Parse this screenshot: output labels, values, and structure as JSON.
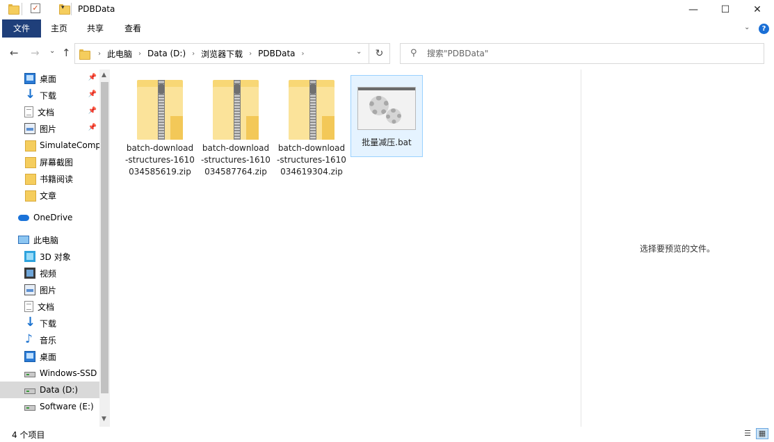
{
  "window": {
    "title": "PDBData",
    "controls": {
      "minimize": "—",
      "maximize": "☐",
      "close": "✕"
    }
  },
  "ribbon": {
    "tabs": [
      {
        "label": "文件"
      },
      {
        "label": "主页"
      },
      {
        "label": "共享"
      },
      {
        "label": "查看"
      }
    ],
    "help": "?"
  },
  "address": {
    "crumbs": [
      "此电脑",
      "Data (D:)",
      "浏览器下载",
      "PDBData"
    ]
  },
  "search": {
    "placeholder": "搜索\"PDBData\""
  },
  "nav": {
    "quick_access": [
      {
        "label": "桌面",
        "icon": "desktop-icon",
        "pinned": true
      },
      {
        "label": "下载",
        "icon": "download-icon",
        "pinned": true
      },
      {
        "label": "文档",
        "icon": "document-icon",
        "pinned": true
      },
      {
        "label": "图片",
        "icon": "pictures-icon",
        "pinned": true
      },
      {
        "label": "SimulateCompr",
        "icon": "folder-icon",
        "pinned": false
      },
      {
        "label": "屏幕截图",
        "icon": "folder-icon",
        "pinned": false
      },
      {
        "label": "书籍阅读",
        "icon": "folder-icon",
        "pinned": false
      },
      {
        "label": "文章",
        "icon": "folder-icon",
        "pinned": false
      }
    ],
    "onedrive": {
      "label": "OneDrive",
      "icon": "onedrive-icon"
    },
    "this_pc": {
      "label": "此电脑",
      "icon": "this-pc-icon"
    },
    "pc_items": [
      {
        "label": "3D 对象",
        "icon": "3d-objects-icon"
      },
      {
        "label": "视频",
        "icon": "video-icon"
      },
      {
        "label": "图片",
        "icon": "pictures-icon"
      },
      {
        "label": "文档",
        "icon": "document-icon"
      },
      {
        "label": "下载",
        "icon": "download-icon"
      },
      {
        "label": "音乐",
        "icon": "music-icon"
      },
      {
        "label": "桌面",
        "icon": "desktop-icon"
      },
      {
        "label": "Windows-SSD",
        "icon": "drive-icon"
      },
      {
        "label": "Data (D:)",
        "icon": "drive-icon",
        "selected": true
      },
      {
        "label": "Software (E:)",
        "icon": "drive-icon"
      }
    ]
  },
  "files": [
    {
      "name": "batch-download-structures-1610034585619.zip",
      "type": "zip"
    },
    {
      "name": "batch-download-structures-1610034587764.zip",
      "type": "zip"
    },
    {
      "name": "batch-download-structures-1610034619304.zip",
      "type": "zip"
    },
    {
      "name": "批量减压.bat",
      "type": "bat",
      "selected": true
    }
  ],
  "preview": {
    "message": "选择要预览的文件。"
  },
  "status": {
    "count": "4 个项目"
  }
}
